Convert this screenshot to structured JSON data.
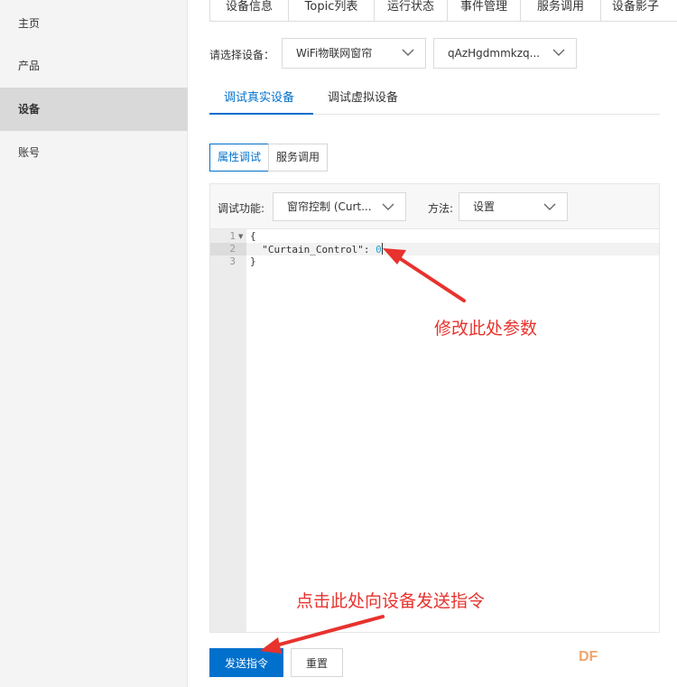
{
  "sidebar": {
    "items": [
      {
        "label": "主页"
      },
      {
        "label": "产品"
      },
      {
        "label": "设备"
      },
      {
        "label": "账号"
      }
    ]
  },
  "top_tabs": [
    "设备信息",
    "Topic列表",
    "运行状态",
    "事件管理",
    "服务调用",
    "设备影子"
  ],
  "device_select": {
    "label": "请选择设备：",
    "product_value": "WiFi物联网窗帘",
    "device_value": "qAzHgdmmkzq..."
  },
  "mode_tabs": [
    "调试真实设备",
    "调试虚拟设备"
  ],
  "segments": [
    "属性调试",
    "服务调用"
  ],
  "panel": {
    "function_label": "调试功能:",
    "function_value": "窗帘控制 (Curt...",
    "method_label": "方法:",
    "method_value": "设置"
  },
  "editor": {
    "line_numbers": [
      "1",
      "2",
      "3"
    ],
    "lines": [
      "{",
      "  \"Curtain_Control\": ",
      "}"
    ],
    "value": "0"
  },
  "buttons": {
    "send": "发送指令",
    "reset": "重置"
  },
  "annotations": {
    "modify": "修改此处参数",
    "click_send": "点击此处向设备发送指令"
  },
  "watermark": "DF",
  "colors": {
    "accent": "#0070cc",
    "annotation": "#e8322d",
    "watermark": "#f2a46c",
    "sidebar_bg": "#f4f4f4",
    "sidebar_active": "#d9d9d9"
  }
}
